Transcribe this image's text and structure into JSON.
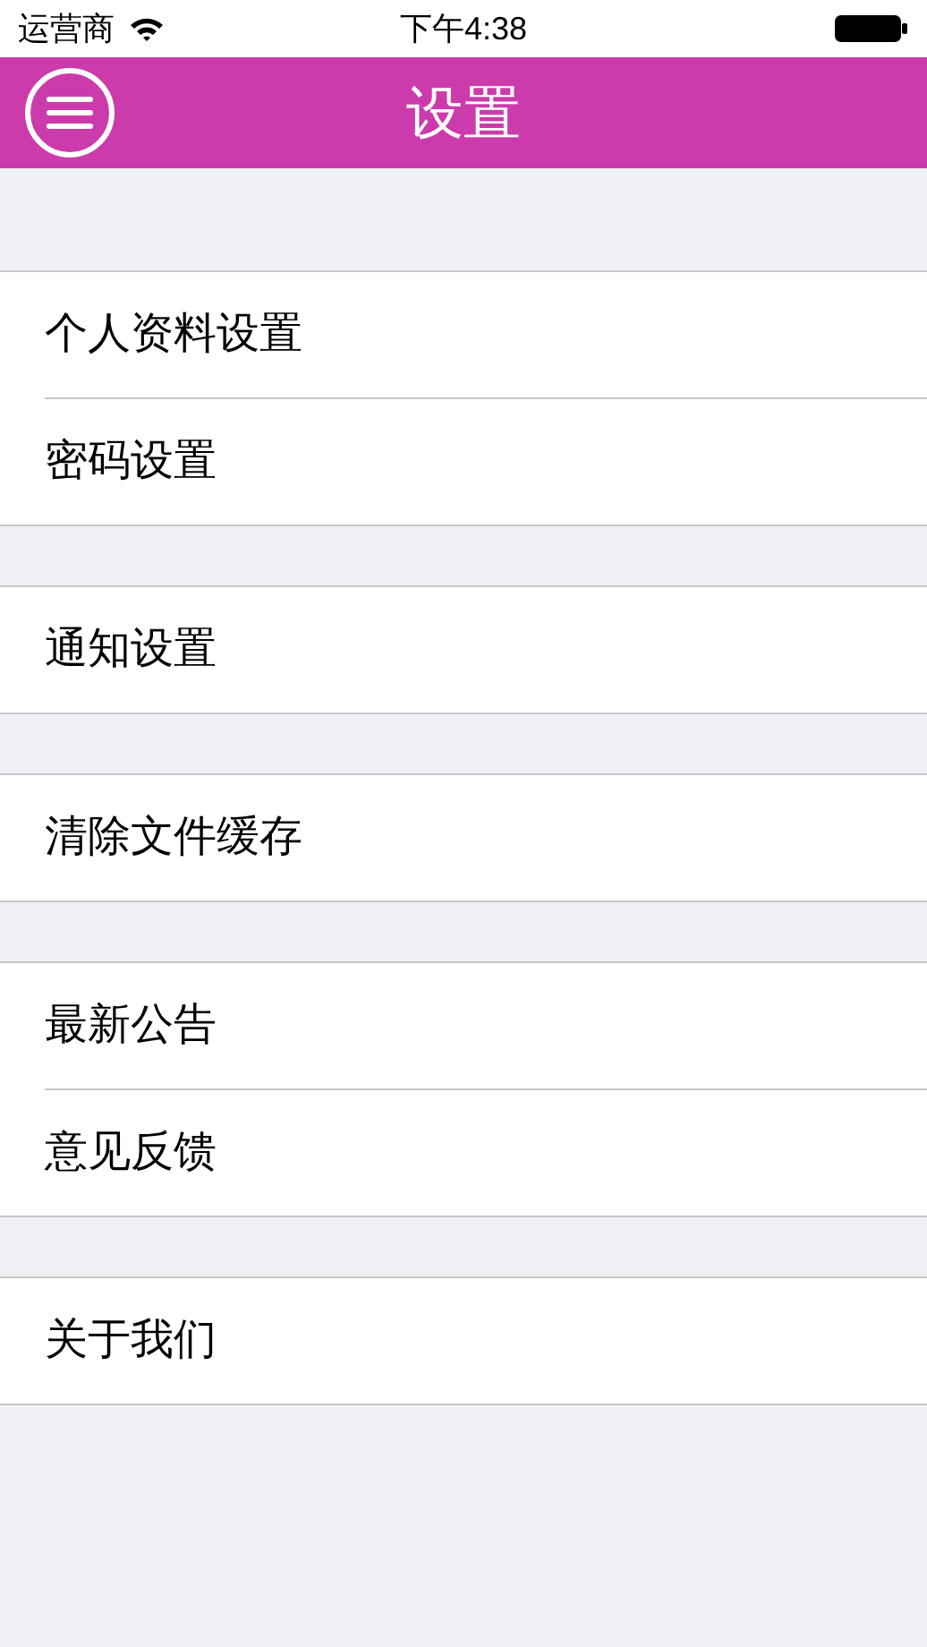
{
  "status_bar": {
    "carrier": "运营商",
    "time": "下午4:38"
  },
  "nav_bar": {
    "title": "设置"
  },
  "groups": [
    {
      "items": [
        "个人资料设置",
        "密码设置"
      ]
    },
    {
      "items": [
        "通知设置"
      ]
    },
    {
      "items": [
        "清除文件缓存"
      ]
    },
    {
      "items": [
        "最新公告",
        "意见反馈"
      ]
    },
    {
      "items": [
        "关于我们"
      ]
    }
  ]
}
